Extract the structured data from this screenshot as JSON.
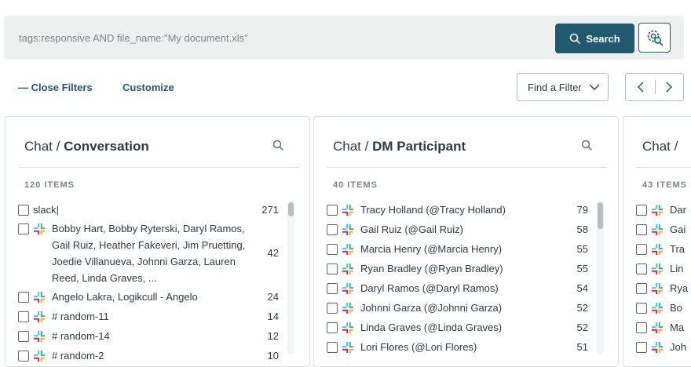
{
  "search": {
    "query": "tags:responsive AND file_name:\"My document.xls\"",
    "button_label": "Search"
  },
  "toolbar": {
    "close_filters": "— Close Filters",
    "customize": "Customize",
    "find_filter": "Find a Filter"
  },
  "colors": {
    "primary": "#1f5a70",
    "muted": "#7d8589",
    "border": "#dadfe1"
  },
  "cards": [
    {
      "title_prefix": "Chat / ",
      "title_main": "Conversation",
      "count": "120 ITEMS",
      "rows": [
        {
          "label": "slack|",
          "count": "271",
          "icon": false
        },
        {
          "label": "Bobby Hart, Bobby Ryterski, Daryl Ramos, Gail Ruiz, Heather Fakeveri, Jim Pruetting, Joedie Villanueva, Johnni Garza, Lauren Reed, Linda Graves, ...",
          "count": "42",
          "icon": true
        },
        {
          "label": "Angelo Lakra, Logikcull - Angelo",
          "count": "24",
          "icon": true
        },
        {
          "label": "# random-11",
          "count": "14",
          "icon": true
        },
        {
          "label": "# random-14",
          "count": "12",
          "icon": true
        },
        {
          "label": "# random-2",
          "count": "10",
          "icon": true
        }
      ]
    },
    {
      "title_prefix": "Chat / ",
      "title_main": "DM Participant",
      "count": "40 ITEMS",
      "rows": [
        {
          "label": "Tracy Holland (@Tracy Holland)",
          "count": "79",
          "icon": true
        },
        {
          "label": "Gail Ruiz (@Gail Ruiz)",
          "count": "58",
          "icon": true
        },
        {
          "label": "Marcia Henry (@Marcia Henry)",
          "count": "55",
          "icon": true
        },
        {
          "label": "Ryan Bradley (@Ryan Bradley)",
          "count": "55",
          "icon": true
        },
        {
          "label": "Daryl Ramos (@Daryl Ramos)",
          "count": "54",
          "icon": true
        },
        {
          "label": "Johnni Garza (@Johnni Garza)",
          "count": "52",
          "icon": true
        },
        {
          "label": "Linda Graves (@Linda Graves)",
          "count": "52",
          "icon": true
        },
        {
          "label": "Lori Flores (@Lori Flores)",
          "count": "51",
          "icon": true
        }
      ]
    },
    {
      "title_prefix": "Chat / ",
      "title_main": "",
      "count": "43 ITEMS",
      "rows": [
        {
          "label": "Dar",
          "count": "",
          "icon": true
        },
        {
          "label": "Gai",
          "count": "",
          "icon": true
        },
        {
          "label": "Tra",
          "count": "",
          "icon": true
        },
        {
          "label": "Lin",
          "count": "",
          "icon": true
        },
        {
          "label": "Rya",
          "count": "",
          "icon": true
        },
        {
          "label": "Bo",
          "count": "",
          "icon": true
        },
        {
          "label": "Ma",
          "count": "",
          "icon": true
        },
        {
          "label": "Joh",
          "count": "",
          "icon": true
        }
      ]
    }
  ]
}
